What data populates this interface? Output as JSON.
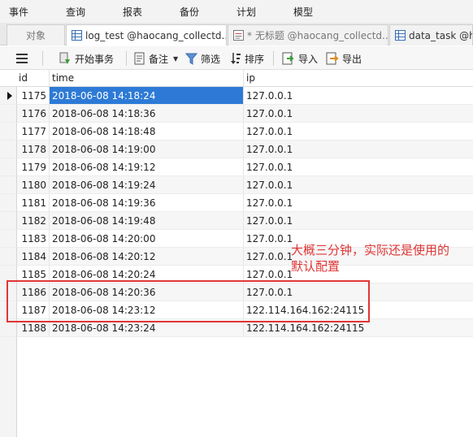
{
  "toolbar": {
    "items": [
      "事件",
      "查询",
      "报表",
      "备份",
      "计划",
      "模型"
    ]
  },
  "tabs": [
    {
      "label": "对象"
    },
    {
      "label": "log_test @haocang_collectd..."
    },
    {
      "label": "* 无标题 @haocang_collectd..."
    },
    {
      "label": "data_task @h"
    }
  ],
  "actions": {
    "menu_icon": "hamburger-icon",
    "begin_transaction": "开始事务",
    "memo": "备注",
    "filter": "筛选",
    "sort": "排序",
    "import": "导入",
    "export": "导出"
  },
  "table": {
    "columns": [
      "id",
      "time",
      "ip"
    ],
    "rows": [
      {
        "id": "1175",
        "time": "2018-06-08 14:18:24",
        "ip": "127.0.0.1"
      },
      {
        "id": "1176",
        "time": "2018-06-08 14:18:36",
        "ip": "127.0.0.1"
      },
      {
        "id": "1177",
        "time": "2018-06-08 14:18:48",
        "ip": "127.0.0.1"
      },
      {
        "id": "1178",
        "time": "2018-06-08 14:19:00",
        "ip": "127.0.0.1"
      },
      {
        "id": "1179",
        "time": "2018-06-08 14:19:12",
        "ip": "127.0.0.1"
      },
      {
        "id": "1180",
        "time": "2018-06-08 14:19:24",
        "ip": "127.0.0.1"
      },
      {
        "id": "1181",
        "time": "2018-06-08 14:19:36",
        "ip": "127.0.0.1"
      },
      {
        "id": "1182",
        "time": "2018-06-08 14:19:48",
        "ip": "127.0.0.1"
      },
      {
        "id": "1183",
        "time": "2018-06-08 14:20:00",
        "ip": "127.0.0.1"
      },
      {
        "id": "1184",
        "time": "2018-06-08 14:20:12",
        "ip": "127.0.0.1"
      },
      {
        "id": "1185",
        "time": "2018-06-08 14:20:24",
        "ip": "127.0.0.1"
      },
      {
        "id": "1186",
        "time": "2018-06-08 14:20:36",
        "ip": "127.0.0.1"
      },
      {
        "id": "1187",
        "time": "2018-06-08 14:23:12",
        "ip": "122.114.164.162:24115"
      },
      {
        "id": "1188",
        "time": "2018-06-08 14:23:24",
        "ip": "122.114.164.162:24115"
      }
    ]
  },
  "annotation": {
    "line1": "大概三分钟，实际还是使用的",
    "line2": "默认配置"
  },
  "colors": {
    "selection": "#2d7ad6",
    "annotation": "#e03535"
  }
}
